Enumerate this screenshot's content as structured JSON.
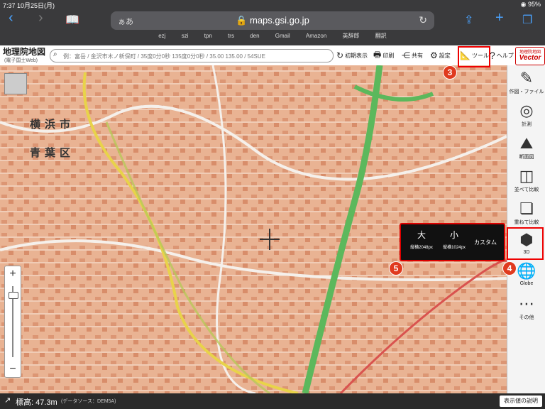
{
  "status": {
    "time_date": "7:37 10月25日(月)",
    "right": "◉ 95%"
  },
  "browser": {
    "aa": "ぁあ",
    "url": "maps.gsi.go.jp",
    "bookmarks": [
      "ezj",
      "szi",
      "tpn",
      "trs",
      "den",
      "Gmail",
      "Amazon",
      "英辞郎",
      "翻訳"
    ]
  },
  "header": {
    "title": "地理院地図",
    "subtitle": "(電子国土Web)",
    "search_placeholder": "例：富岳 / 金沢市木ノ新保町 / 35度0分0秒 135度0分0秒 / 35.00 135.00 / 54SUE",
    "reset": "初期表示",
    "print": "印刷",
    "share": "共有",
    "settings": "設定",
    "tools": "ツール",
    "help": "ヘルプ",
    "logo_top": "地理院地図",
    "logo_bottom": "Vector"
  },
  "map": {
    "label_city": "横浜市",
    "label_ward": "青葉区"
  },
  "toolbar": {
    "items": [
      "作図・ファイル",
      "計測",
      "断面図",
      "並べて比較",
      "重ねて比較",
      "3D",
      "Globe",
      "その他"
    ]
  },
  "popup": {
    "large": "大",
    "large_size": "縦横2048px",
    "small": "小",
    "small_size": "縦横1024px",
    "custom": "カスタム"
  },
  "badges": {
    "b3": "3",
    "b4": "4",
    "b5": "5"
  },
  "bottom": {
    "elevation": "標高: 47.3m",
    "source": "(データソース：DEM5A)",
    "legend": "表示値の説明"
  },
  "colors": {
    "map_base": "#e9b393",
    "road_green": "#5cb85c",
    "highlight": "#e00000"
  }
}
